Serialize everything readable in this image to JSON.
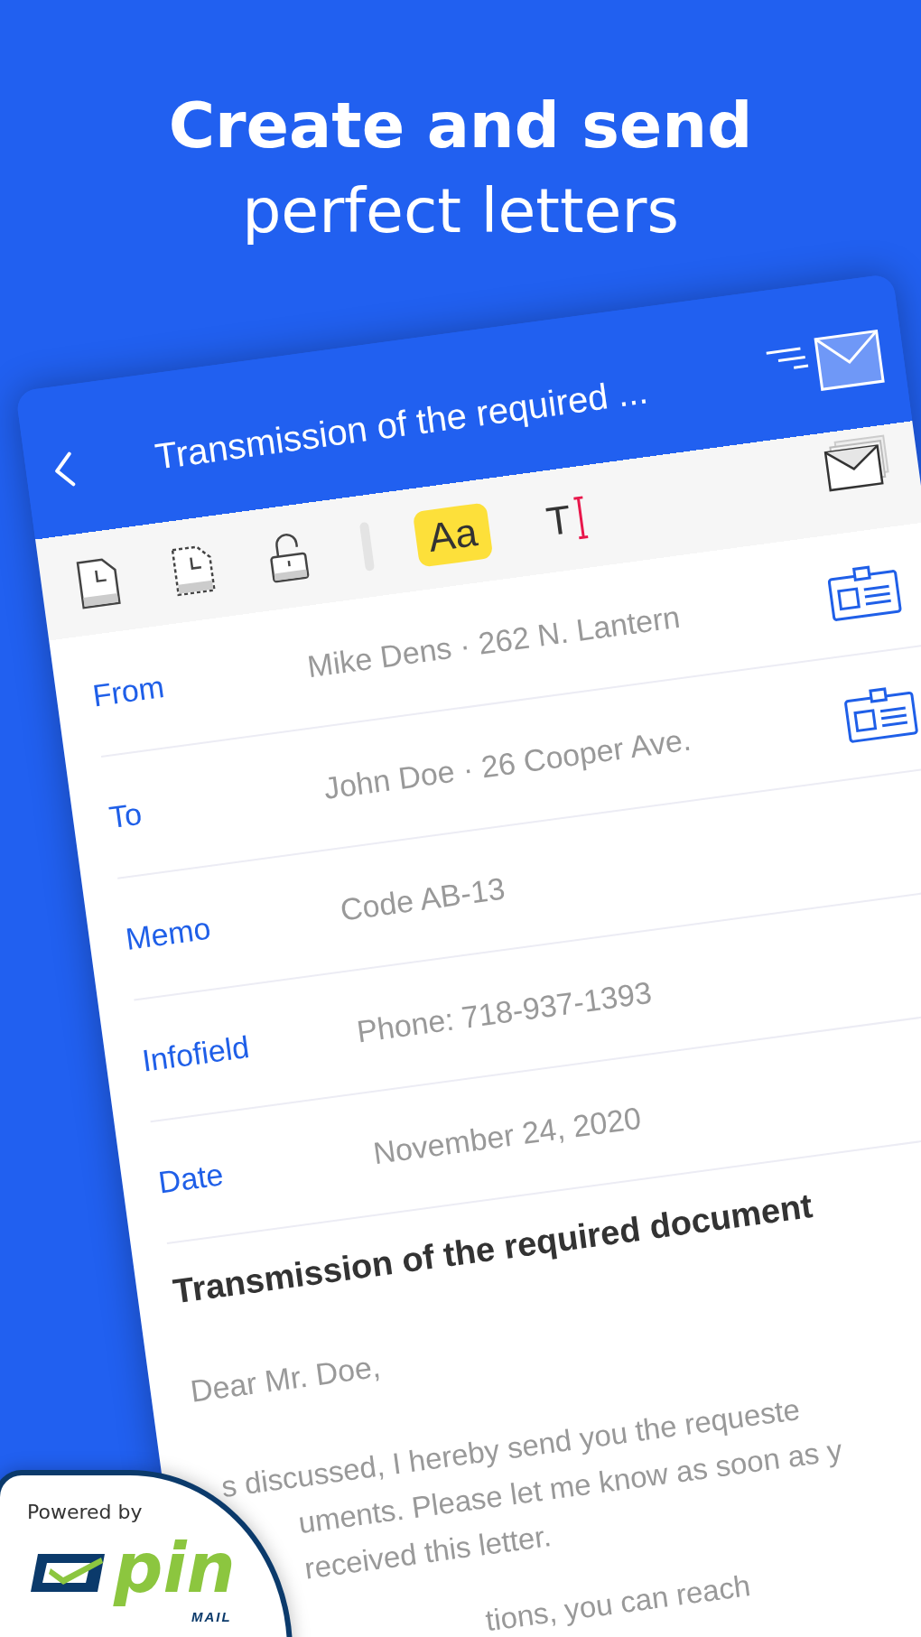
{
  "headline": {
    "line_1": "Create and send",
    "line_2": "perfect letters"
  },
  "app": {
    "header": {
      "title": "Transmission of the required ..."
    },
    "toolbar": [
      {
        "kind": "document"
      },
      {
        "kind": "dashed-document"
      },
      {
        "kind": "lock"
      },
      {
        "kind": "separator"
      },
      {
        "kind": "text-style",
        "label": "Aa",
        "selected": true
      },
      {
        "kind": "text-cursor",
        "label": "T",
        "selected": false
      }
    ],
    "fields": [
      {
        "label": "From",
        "value": "Mike Dens · 262 N. Lantern",
        "contact_card": true
      },
      {
        "label": "To",
        "value": "John Doe · 26 Cooper Ave.",
        "contact_card": true
      },
      {
        "label": "Memo",
        "value": "Code AB-13",
        "contact_card": false
      },
      {
        "label": "Infofield",
        "value": "Phone: 718-937-1393",
        "contact_card": false
      },
      {
        "label": "Date",
        "value": "November 24, 2020",
        "contact_card": false
      }
    ],
    "letter": {
      "subject": "Transmission of the required document",
      "salutation": "Dear Mr. Doe,",
      "body_lines": [
        "s discussed, I hereby send you the requeste",
        "uments. Please let me know as soon as y",
        "received this letter.",
        "tions, you can reach"
      ]
    }
  },
  "badge": {
    "caption": "Powered by",
    "logo_word": "pin",
    "logo_sub": "MAIL"
  }
}
